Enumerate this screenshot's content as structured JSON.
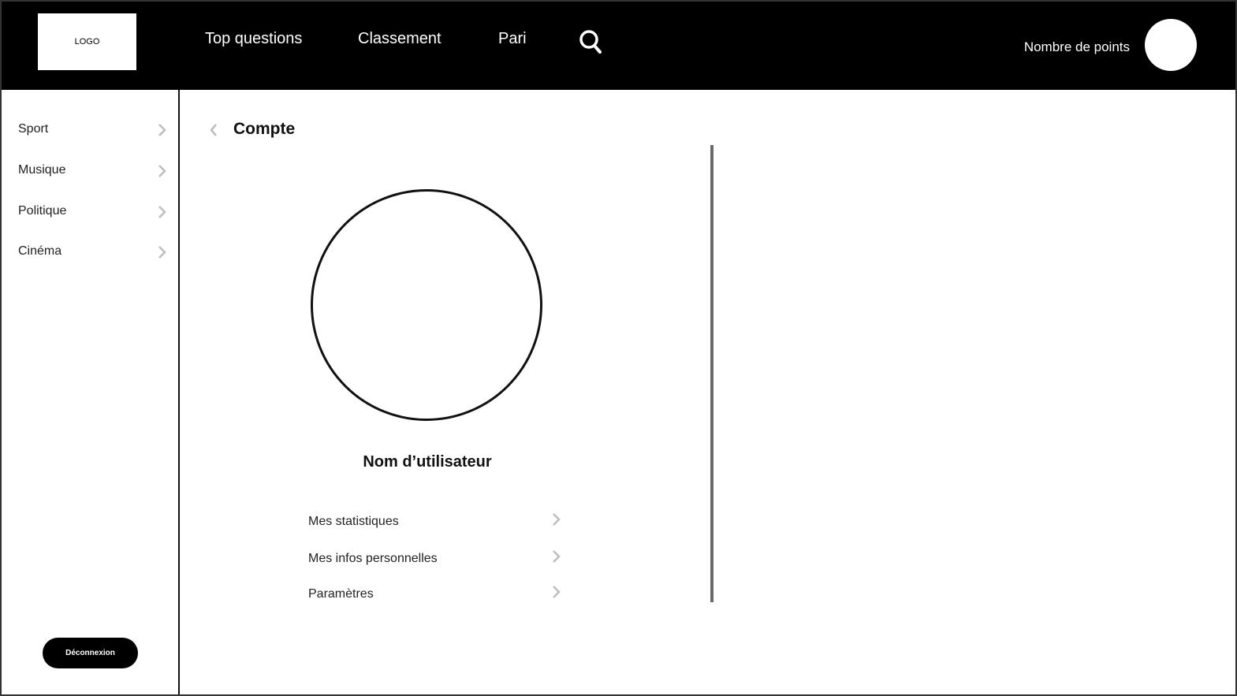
{
  "header": {
    "logo_text": "LOGO",
    "nav": [
      {
        "label": "Top questions"
      },
      {
        "label": "Classement"
      },
      {
        "label": "Pari"
      }
    ],
    "search_icon": "search-icon",
    "points_label": "Nombre de points"
  },
  "sidebar": {
    "items": [
      {
        "label": "Sport"
      },
      {
        "label": "Musique"
      },
      {
        "label": "Politique"
      },
      {
        "label": "Cinéma"
      }
    ],
    "logout_label": "Déconnexion"
  },
  "main": {
    "title": "Compte",
    "username": "Nom d’utilisateur",
    "menu": [
      {
        "label": "Mes statistiques"
      },
      {
        "label": "Mes infos personnelles"
      },
      {
        "label": "Paramètres"
      }
    ]
  },
  "colors": {
    "header_bg": "#000000",
    "chevron": "#bdbdbd",
    "divider": "#6a6a6a"
  }
}
